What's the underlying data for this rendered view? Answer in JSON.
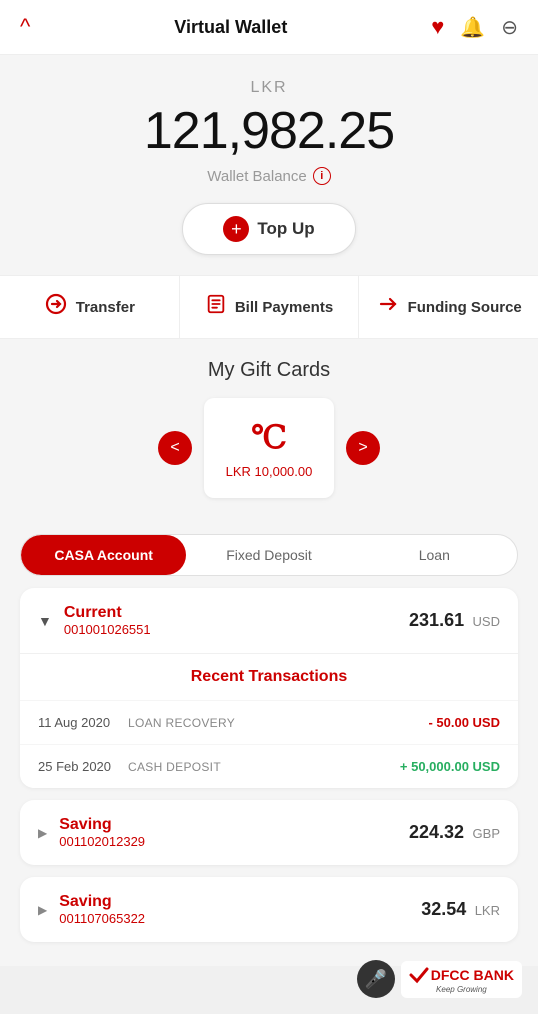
{
  "header": {
    "back_label": "^",
    "title": "Virtual Wallet",
    "heart_icon": "♥",
    "bell_icon": "🔔",
    "logout_icon": "⊖"
  },
  "balance": {
    "currency": "LKR",
    "amount": "121,982.25",
    "label": "Wallet Balance",
    "info_icon": "i"
  },
  "topup_button": {
    "label": "Top Up",
    "plus": "+"
  },
  "actions": [
    {
      "id": "transfer",
      "icon": "↔",
      "label": "Transfer"
    },
    {
      "id": "bill-payments",
      "icon": "📋",
      "label": "Bill Payments"
    },
    {
      "id": "funding-source",
      "icon": "↔",
      "label": "Funding Source"
    }
  ],
  "gift_cards": {
    "title": "My Gift Cards",
    "card": {
      "spinner": "C",
      "amount": "LKR 10,000.00"
    },
    "nav_left": "<",
    "nav_right": ">"
  },
  "tabs": {
    "items": [
      {
        "id": "casa",
        "label": "CASA Account",
        "active": true
      },
      {
        "id": "fixed",
        "label": "Fixed Deposit",
        "active": false
      },
      {
        "id": "loan",
        "label": "Loan",
        "active": false
      }
    ]
  },
  "accounts": [
    {
      "id": "account-1",
      "name": "Current",
      "number": "001001026551",
      "balance": "231.61",
      "currency": "USD",
      "expanded": true,
      "transactions_title": "Recent Transactions",
      "transactions": [
        {
          "date": "11 Aug 2020",
          "description": "LOAN RECOVERY",
          "amount": "- 50.00 USD",
          "type": "negative"
        },
        {
          "date": "25 Feb 2020",
          "description": "CASH DEPOSIT",
          "amount": "+ 50,000.00 USD",
          "type": "positive"
        }
      ]
    },
    {
      "id": "account-2",
      "name": "Saving",
      "number": "001102012329",
      "balance": "224.32",
      "currency": "GBP",
      "expanded": false,
      "transactions": []
    },
    {
      "id": "account-3",
      "name": "Saving",
      "number": "001107065322",
      "balance": "32.54",
      "currency": "LKR",
      "expanded": false,
      "transactions": []
    }
  ],
  "footer": {
    "mic_icon": "🎤",
    "brand_name_prefix": "DFCC",
    "brand_name_suffix": " BANK",
    "tagline": "Keep Growing"
  }
}
